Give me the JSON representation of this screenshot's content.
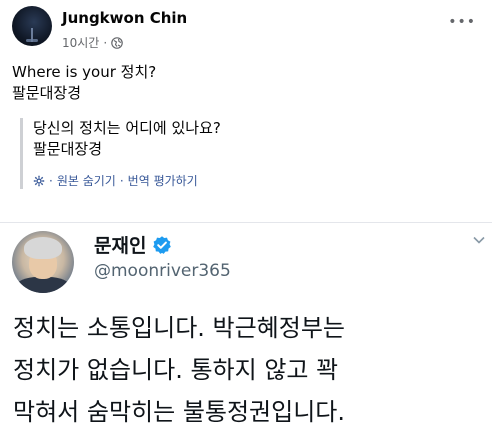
{
  "post": {
    "author": "Jungkwon Chin",
    "time": "10시간",
    "dot": "·",
    "text_lines": [
      "Where is your 정치?",
      "팔문대장경"
    ],
    "translation": {
      "lines": [
        "당신의 정치는 어디에 있나요?",
        "팔문대장경"
      ],
      "show_original": "원본 숨기기",
      "separator": "·",
      "rate": "번역 평가하기"
    },
    "more_icon": "three-dots-icon",
    "privacy_icon": "globe-icon"
  },
  "tweet": {
    "name": "문재인",
    "handle": "@moonriver365",
    "body_lines": [
      "정치는 소통입니다. 박근혜정부는",
      "정치가 없습니다. 통하지 않고 꽉",
      "막혀서 숨막히는 불통정권입니다."
    ],
    "verified_color": "#1d9bf0"
  }
}
